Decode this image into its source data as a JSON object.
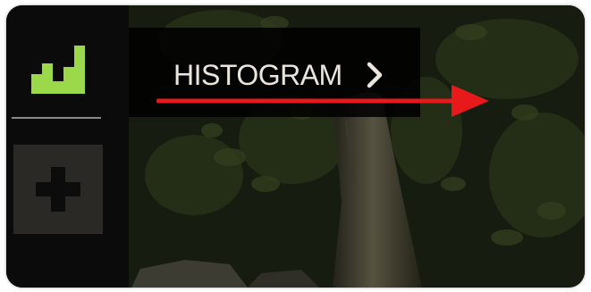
{
  "sidebar": {
    "histogram_button": {
      "icon": "histogram-icon",
      "accent_color": "#9bd94b"
    },
    "add_button": {
      "icon": "plus-icon",
      "color": "#0c0c0c"
    }
  },
  "menu": {
    "items": [
      {
        "label": "HISTOGRAM",
        "icon": "chevron-right-icon"
      }
    ]
  },
  "annotation": {
    "type": "arrow",
    "color": "#e8191a"
  }
}
